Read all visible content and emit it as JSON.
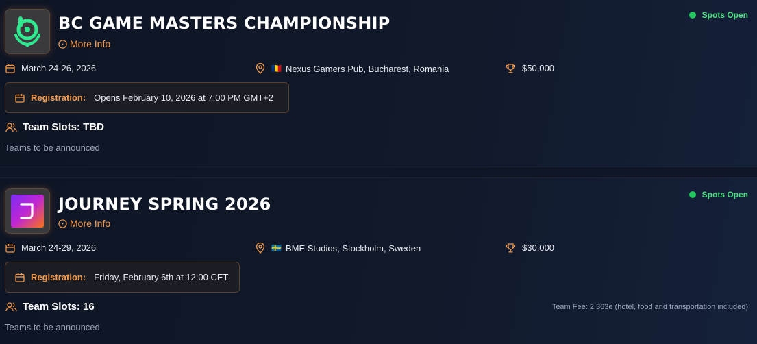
{
  "tournaments": [
    {
      "title": "BC GAME MASTERS CHAMPIONSHIP",
      "more_info": "More Info",
      "status": "Spots Open",
      "date": "March 24-26, 2026",
      "flag": "🇷🇴",
      "location": "Nexus Gamers Pub, Bucharest, Romania",
      "prize": "$50,000",
      "registration_label": "Registration:",
      "registration_value": "Opens February 10, 2026 at 7:00 PM GMT+2",
      "team_slots": "Team Slots: TBD",
      "teams_note": "Teams to be announced",
      "logo_icon": "bc-game-logo-icon"
    },
    {
      "title": "JOURNEY SPRING 2026",
      "more_info": "More Info",
      "status": "Spots Open",
      "date": "March 24-29, 2026",
      "flag": "🇸🇪",
      "location": "BME Studios, Stockholm, Sweden",
      "prize": "$30,000",
      "registration_label": "Registration:",
      "registration_value": "Friday, February 6th at 12:00 CET",
      "team_slots": "Team Slots: 16",
      "team_fee": "Team Fee: 2 363e (hotel, food and transportation included)",
      "teams_note": "Teams to be announced",
      "logo_icon": "journey-logo-icon"
    }
  ],
  "colors": {
    "accent": "#f59a4a",
    "status_green": "#22c55e",
    "background": "#0f1626"
  }
}
